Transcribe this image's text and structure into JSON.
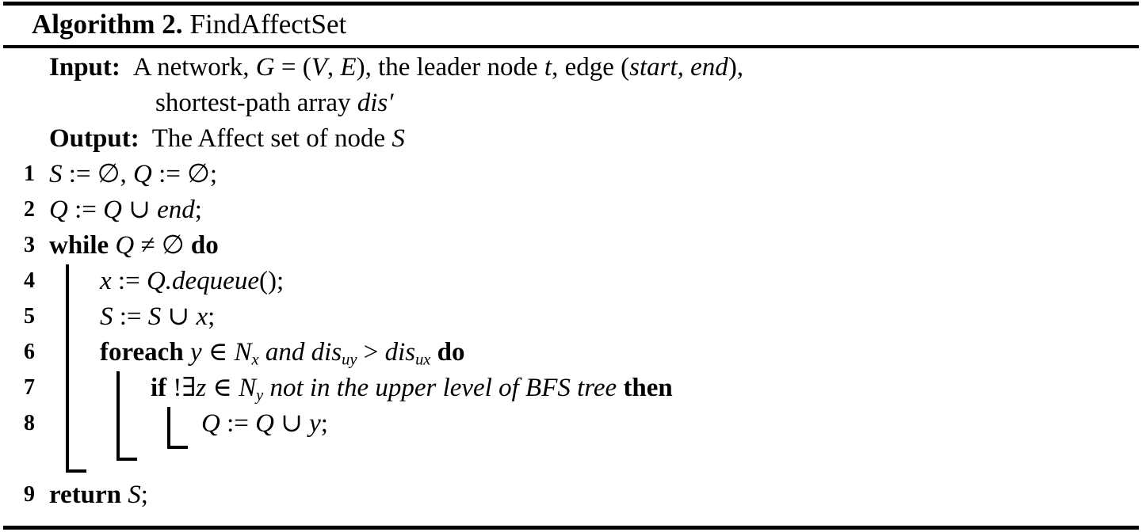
{
  "title": {
    "keyword": "Algorithm 2.",
    "name": "FindAffectSet"
  },
  "io": {
    "input_label": "Input:",
    "input_line1_a": "A network, ",
    "input_G": "G",
    "input_eq": " = (",
    "input_V": "V",
    "input_comma": ", ",
    "input_E": "E",
    "input_line1_b": "), the leader node ",
    "input_t": "t",
    "input_line1_c": ", edge (",
    "input_start": "start",
    "input_sep": ", ",
    "input_end": "end",
    "input_line1_d": "),",
    "input_line2_a": "shortest-path array ",
    "input_dis": "dis",
    "input_prime": "′",
    "output_label": "Output:",
    "output_text_a": "The Affect set of node ",
    "output_S": "S"
  },
  "lines": [
    {
      "number": "1",
      "indent": 0,
      "parts": [
        {
          "t": "S",
          "s": "mi"
        },
        {
          "t": " := ",
          "s": "mtxt"
        },
        {
          "t": "∅",
          "s": "mtxt"
        },
        {
          "t": ", ",
          "s": "mtxt"
        },
        {
          "t": "Q",
          "s": "mi"
        },
        {
          "t": " := ",
          "s": "mtxt"
        },
        {
          "t": "∅",
          "s": "mtxt"
        },
        {
          "t": ";",
          "s": "mtxt"
        }
      ]
    },
    {
      "number": "2",
      "indent": 0,
      "parts": [
        {
          "t": "Q",
          "s": "mi"
        },
        {
          "t": " := ",
          "s": "mtxt"
        },
        {
          "t": "Q",
          "s": "mi"
        },
        {
          "t": " ∪ ",
          "s": "mtxt"
        },
        {
          "t": "end",
          "s": "mi"
        },
        {
          "t": ";",
          "s": "mtxt"
        }
      ]
    },
    {
      "number": "3",
      "indent": 0,
      "parts": [
        {
          "t": "while",
          "s": "bkw"
        },
        {
          "t": " ",
          "s": "mtxt"
        },
        {
          "t": "Q",
          "s": "mi"
        },
        {
          "t": " ≠ ",
          "s": "mtxt"
        },
        {
          "t": "∅",
          "s": "mtxt"
        },
        {
          "t": " ",
          "s": "mtxt"
        },
        {
          "t": "do",
          "s": "bkw"
        }
      ]
    },
    {
      "number": "4",
      "indent": 1,
      "parts": [
        {
          "t": "x",
          "s": "mi"
        },
        {
          "t": " := ",
          "s": "mtxt"
        },
        {
          "t": "Q",
          "s": "mi"
        },
        {
          "t": ".",
          "s": "mi"
        },
        {
          "t": "dequeue",
          "s": "mi"
        },
        {
          "t": "();",
          "s": "mtxt"
        }
      ]
    },
    {
      "number": "5",
      "indent": 1,
      "parts": [
        {
          "t": "S",
          "s": "mi"
        },
        {
          "t": " := ",
          "s": "mtxt"
        },
        {
          "t": "S",
          "s": "mi"
        },
        {
          "t": " ∪ ",
          "s": "mtxt"
        },
        {
          "t": "x",
          "s": "mi"
        },
        {
          "t": ";",
          "s": "mtxt"
        }
      ]
    },
    {
      "number": "6",
      "indent": 1,
      "parts": [
        {
          "t": "foreach",
          "s": "bkw"
        },
        {
          "t": " ",
          "s": "mtxt"
        },
        {
          "t": "y",
          "s": "mi"
        },
        {
          "t": " ∈ ",
          "s": "mtxt"
        },
        {
          "t": "N",
          "s": "mi",
          "sub": "x"
        },
        {
          "t": "  ",
          "s": "mtxt"
        },
        {
          "t": "and",
          "s": "itxt"
        },
        {
          "t": " ",
          "s": "mtxt"
        },
        {
          "t": "dis",
          "s": "mi",
          "sub": "uy"
        },
        {
          "t": " > ",
          "s": "mtxt"
        },
        {
          "t": "dis",
          "s": "mi",
          "sub": "ux"
        },
        {
          "t": " ",
          "s": "mtxt"
        },
        {
          "t": "do",
          "s": "bkw"
        }
      ]
    },
    {
      "number": "7",
      "indent": 2,
      "parts": [
        {
          "t": "if",
          "s": "bkw"
        },
        {
          "t": " !∃",
          "s": "mtxt"
        },
        {
          "t": "z",
          "s": "mi"
        },
        {
          "t": " ∈ ",
          "s": "mtxt"
        },
        {
          "t": "N",
          "s": "mi",
          "sub": "y"
        },
        {
          "t": "  ",
          "s": "mtxt"
        },
        {
          "t": "not in the upper level of BFS tree",
          "s": "itxt"
        },
        {
          "t": " ",
          "s": "mtxt"
        },
        {
          "t": "then",
          "s": "bkw"
        }
      ]
    },
    {
      "number": "8",
      "indent": 3,
      "parts": [
        {
          "t": "Q",
          "s": "mi"
        },
        {
          "t": " := ",
          "s": "mtxt"
        },
        {
          "t": "Q",
          "s": "mi"
        },
        {
          "t": " ∪ ",
          "s": "mtxt"
        },
        {
          "t": "y",
          "s": "mi"
        },
        {
          "t": ";",
          "s": "mtxt"
        }
      ]
    },
    {
      "number": "9",
      "indent": 0,
      "parts": [
        {
          "t": "return",
          "s": "bkw"
        },
        {
          "t": " ",
          "s": "mtxt"
        },
        {
          "t": "S",
          "s": "mi"
        },
        {
          "t": ";",
          "s": "mtxt"
        }
      ]
    }
  ],
  "colors": {
    "ink": "#000000",
    "paper": "#ffffff"
  }
}
